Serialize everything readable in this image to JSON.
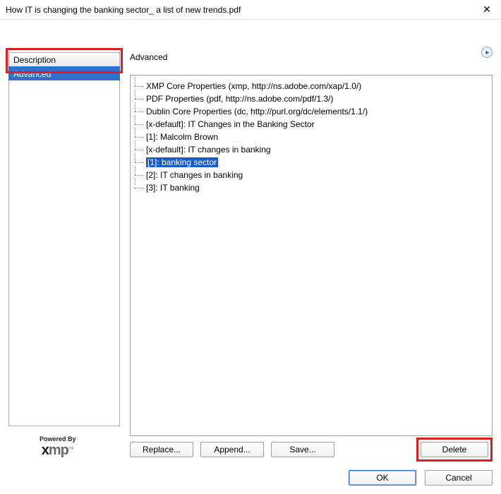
{
  "titlebar": {
    "title": "How IT is changing the banking sector_ a list of new trends.pdf"
  },
  "sidebar": {
    "tabs": [
      {
        "label": "Description"
      },
      {
        "label": "Advanced"
      }
    ]
  },
  "panel": {
    "heading": "Advanced"
  },
  "tree": {
    "items": [
      "XMP Core Properties (xmp, http://ns.adobe.com/xap/1.0/)",
      "PDF Properties (pdf, http://ns.adobe.com/pdf/1.3/)",
      "Dublin Core Properties (dc, http://purl.org/dc/elements/1.1/)",
      "[x-default]: IT Changes in the Banking Sector",
      "[1]: Malcolm Brown",
      "[x-default]: IT changes in banking",
      "[1]: banking sector",
      "[2]: IT changes in banking",
      "[3]: IT banking"
    ]
  },
  "buttons": {
    "replace": "Replace...",
    "append": "Append...",
    "save": "Save...",
    "delete": "Delete",
    "ok": "OK",
    "cancel": "Cancel"
  },
  "footer": {
    "powered_by": "Powered By",
    "logo_x": "x",
    "logo_mp": "mp",
    "logo_tm": "™"
  }
}
